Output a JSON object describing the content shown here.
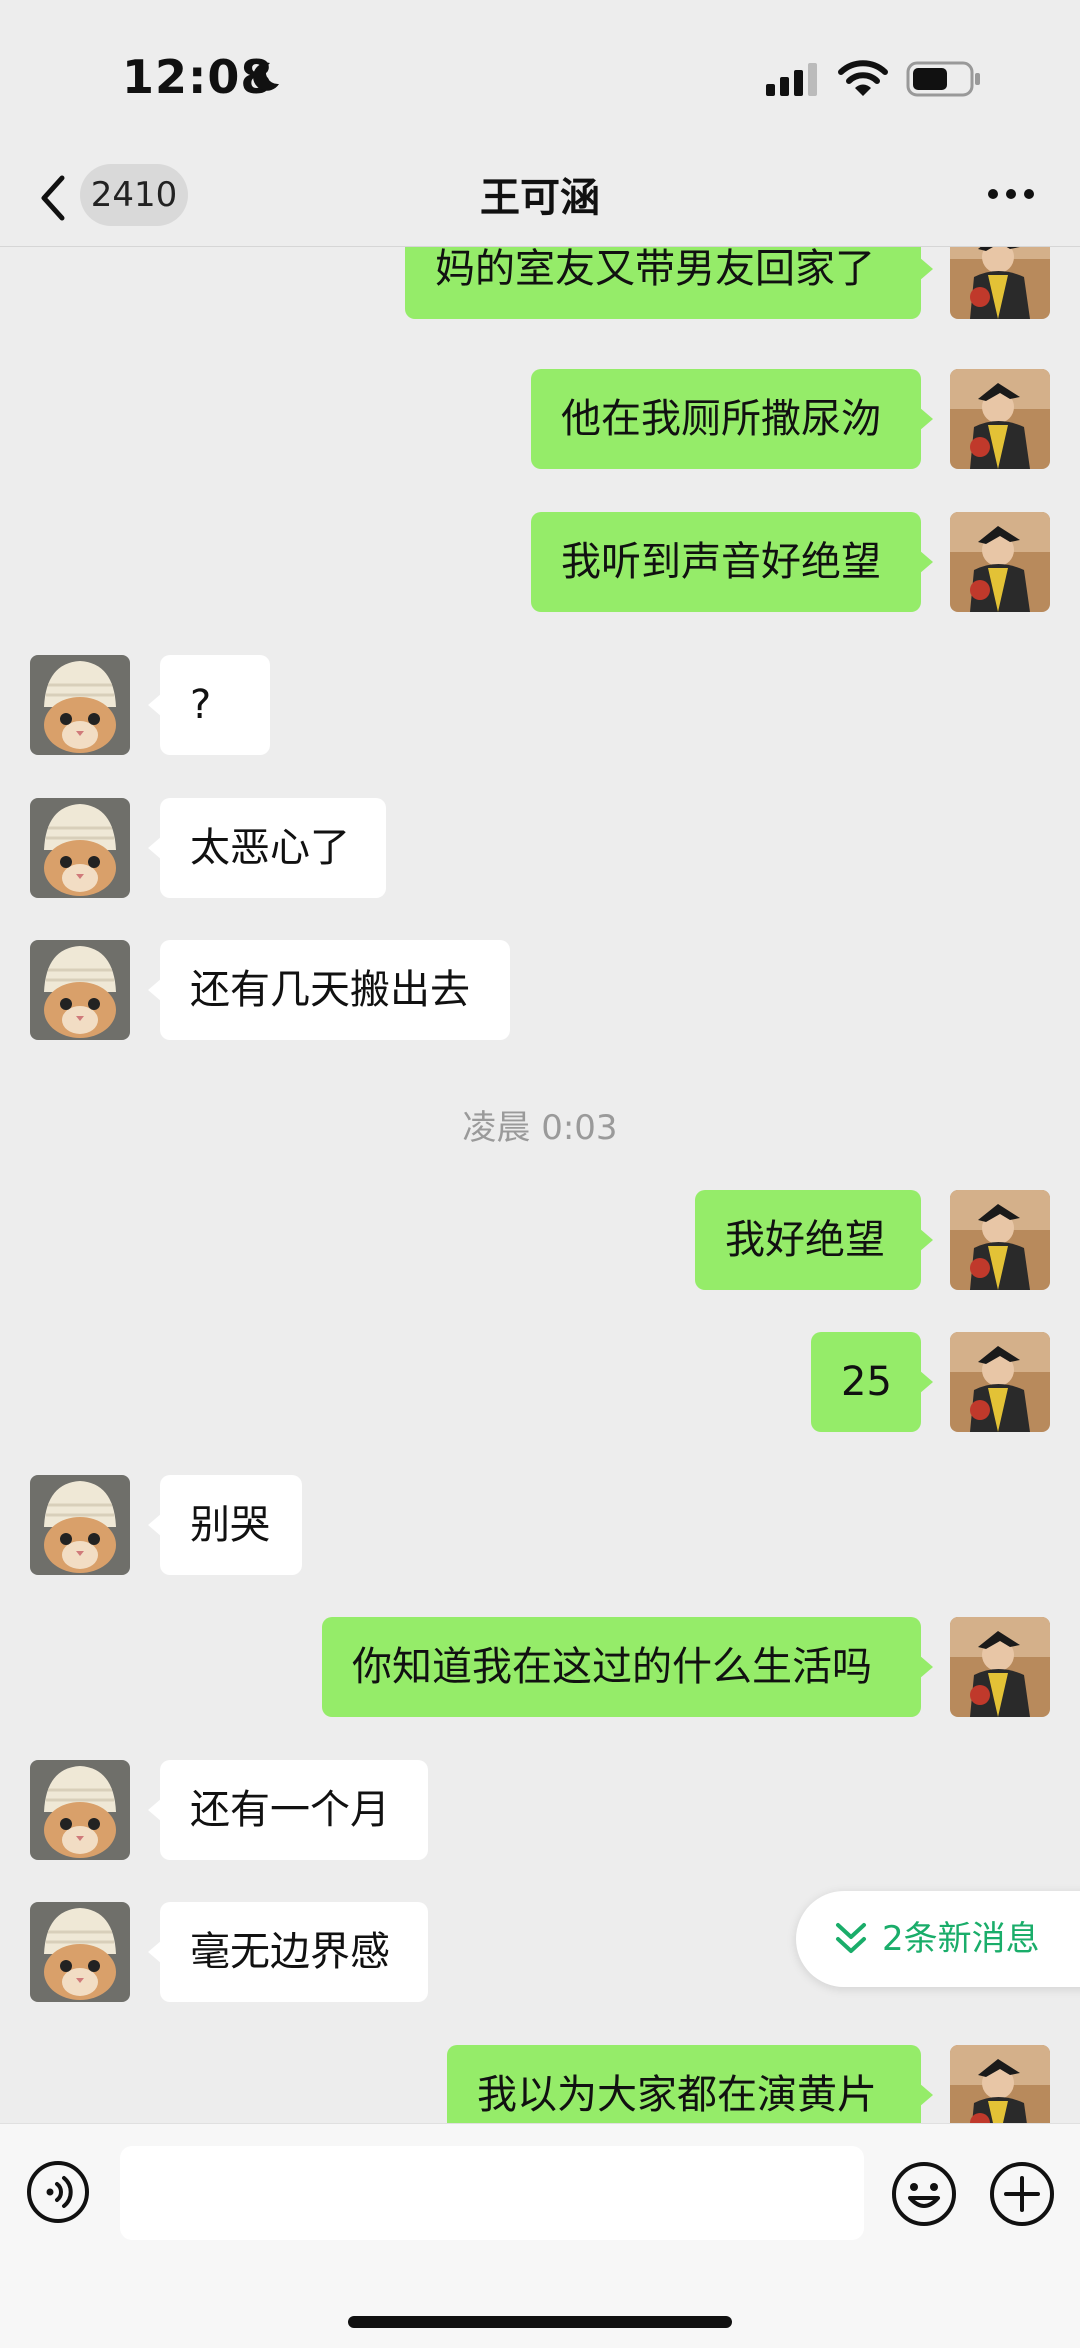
{
  "status_bar": {
    "time": "12:08"
  },
  "header": {
    "back_badge": "2410",
    "title": "王可涵"
  },
  "messages": [
    {
      "side": "out",
      "text": "妈的室友又带男友回家了"
    },
    {
      "side": "out",
      "text": "他在我厕所撒尿沕"
    },
    {
      "side": "out",
      "text": "我听到声音好绝望"
    },
    {
      "side": "in",
      "text": "?"
    },
    {
      "side": "in",
      "text": "太恶心了"
    },
    {
      "side": "in",
      "text": "还有几天搬出去"
    },
    {
      "side": "out",
      "text": "我好绝望"
    },
    {
      "side": "out",
      "text": "25"
    },
    {
      "side": "in",
      "text": "别哭"
    },
    {
      "side": "out",
      "text": "你知道我在这过的什么生活吗"
    },
    {
      "side": "in",
      "text": "还有一个月"
    },
    {
      "side": "in",
      "text": "毫无边界感"
    },
    {
      "side": "out",
      "text": "我以为大家都在演黄片"
    }
  ],
  "timestamp": "凌晨 0:03",
  "new_messages_pill": "2条新消息",
  "input": {
    "value": ""
  },
  "colors": {
    "out_bubble": "#95ec69",
    "in_bubble": "#ffffff",
    "background": "#ededed",
    "accent": "#1aad6a"
  },
  "icons": [
    "moon-icon",
    "cellular-signal-icon",
    "wifi-icon",
    "battery-icon",
    "back-chevron-icon",
    "more-dots-icon",
    "double-chevron-down-icon",
    "voice-icon",
    "emoji-icon",
    "plus-icon"
  ]
}
